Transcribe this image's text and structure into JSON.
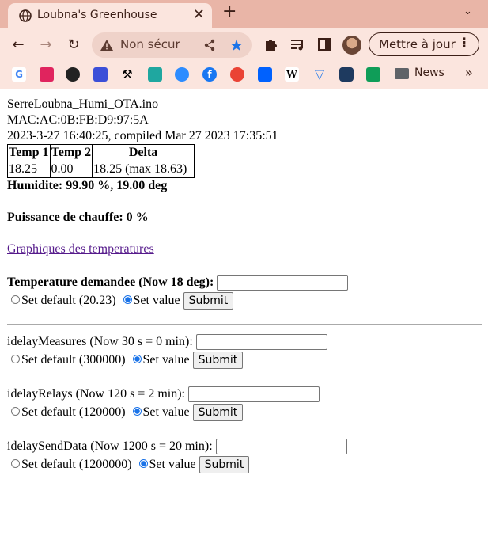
{
  "browser": {
    "tab_title": "Loubna's Greenhouse",
    "omnibox_text": "Non sécur",
    "update_button": "Mettre à jour",
    "bookmarks": [
      "G",
      "",
      "",
      "",
      "",
      "",
      "",
      "",
      "",
      "",
      "W",
      "",
      "",
      ""
    ],
    "news_label": "News"
  },
  "page": {
    "filename": "SerreLoubna_Humi_OTA.ino",
    "mac": "MAC:AC:0B:FB:D9:97:5A",
    "datetime": "2023-3-27 16:40:25, compiled Mar 27 2023 17:35:51",
    "table": {
      "headers": [
        "Temp 1",
        "Temp 2",
        "Delta"
      ],
      "row": [
        "18.25",
        "0.00",
        "18.25 (max 18.63)"
      ]
    },
    "humidity": "Humidite: 99.90 %, 19.00 deg",
    "heating": "Puissance de chauffe: 0 %",
    "graph_link": "Graphiques des temperatures",
    "temp_form": {
      "label": "Temperature demandee (Now 18 deg):",
      "default_label": "Set default (20.23)",
      "value_label": "Set value",
      "submit": "Submit"
    },
    "measures_form": {
      "label": "idelayMeasures (Now 30 s = 0 min):",
      "default_label": "Set default (300000)",
      "value_label": "Set value",
      "submit": "Submit"
    },
    "relays_form": {
      "label": "idelayRelays (Now 120 s = 2 min):",
      "default_label": "Set default (120000)",
      "value_label": "Set value",
      "submit": "Submit"
    },
    "senddata_form": {
      "label": "idelaySendData (Now 1200 s = 20 min):",
      "default_label": "Set default (1200000)",
      "value_label": "Set value",
      "submit": "Submit"
    }
  }
}
